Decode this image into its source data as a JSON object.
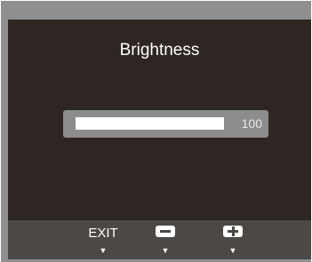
{
  "osd": {
    "title": "Brightness",
    "slider": {
      "value_label": "100",
      "fill_fraction": 1.0
    }
  },
  "buttons": {
    "exit_label": "EXIT",
    "minus_icon": "minus-icon",
    "plus_icon": "plus-icon",
    "arrow_glyph": "▼"
  },
  "colors": {
    "bezel": "#8f8f8f",
    "osd_background": "#2e2622",
    "button_bar": "#4b4845",
    "slider_box": "#8c8c8c",
    "slider_fill": "#ffffff"
  }
}
